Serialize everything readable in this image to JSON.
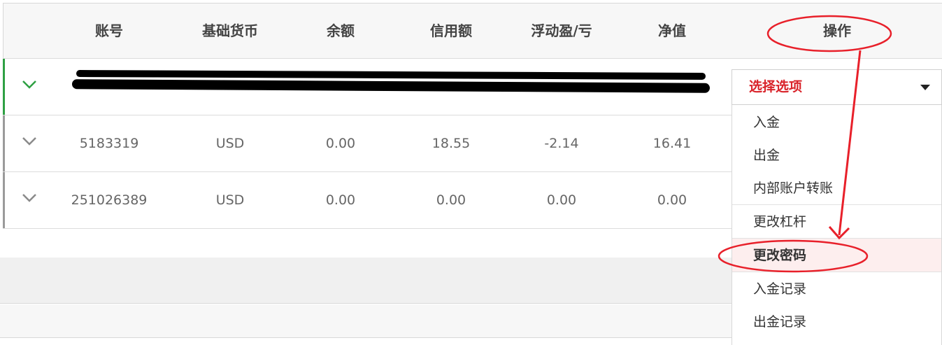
{
  "table": {
    "headers": [
      "账号",
      "基础货币",
      "余额",
      "信用额",
      "浮动盈/亏",
      "净值",
      "操作"
    ],
    "rows": [
      {
        "account": "",
        "currency": "",
        "balance": "",
        "credit": "",
        "pnl": "",
        "equity": ""
      },
      {
        "account": "5183319",
        "currency": "USD",
        "balance": "0.00",
        "credit": "18.55",
        "pnl": "-2.14",
        "equity": "16.41"
      },
      {
        "account": "251026389",
        "currency": "USD",
        "balance": "0.00",
        "credit": "0.00",
        "pnl": "0.00",
        "equity": "0.00"
      }
    ]
  },
  "actions": {
    "selected": "选择选项",
    "options": [
      "入金",
      "出金",
      "内部账户转账",
      "更改杠杆",
      "更改密码",
      "入金记录",
      "出金记录"
    ]
  },
  "colors": {
    "accent_red": "#d9232a",
    "active_green": "#2ea043",
    "annotation_red": "#e8202a"
  },
  "icons": {
    "row_toggle": "chevron-down-icon",
    "select_caret": "caret-down-icon"
  }
}
